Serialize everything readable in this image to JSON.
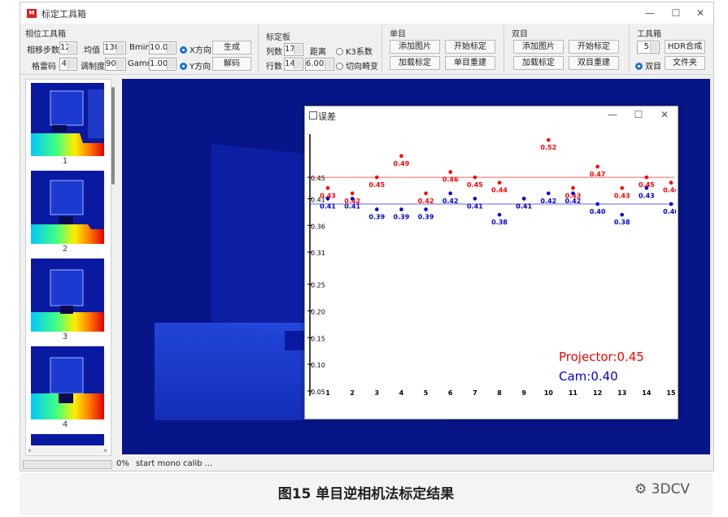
{
  "window": {
    "title": "标定工具箱",
    "controls": [
      "—",
      "☐",
      "✕"
    ]
  },
  "phase_group": {
    "title": "相位工具箱",
    "step_label": "相移步数",
    "step_value": "12",
    "mean_label": "均值",
    "mean_value": "130",
    "bmin_label": "Bmin",
    "bmin_value": "10.00",
    "gray_label": "格雷码",
    "gray_value": "4",
    "mod_label": "调制度",
    "mod_value": "90",
    "gamma_label": "Gamma",
    "gamma_value": "1.00",
    "radio_x": "X方向",
    "radio_y": "Y方向",
    "btn_generate": "生成",
    "btn_decode": "解码"
  },
  "board_group": {
    "title": "标定板",
    "cols_label": "列数",
    "cols_value": "17",
    "rows_label": "行数",
    "rows_value": "14",
    "dist_label": "距离",
    "dist_value": "6.00",
    "radio_k3": "K3系数",
    "radio_tan": "切向畸变"
  },
  "mono_group": {
    "title": "单目",
    "btn_add": "添加图片",
    "btn_start": "开始标定",
    "btn_load": "加载标定",
    "btn_rebuild": "单目重建"
  },
  "stereo_group": {
    "title": "双目",
    "btn_add": "添加图片",
    "btn_start": "开始标定",
    "btn_load": "加载标定",
    "btn_rebuild": "双目重建"
  },
  "tools_group": {
    "title": "工具箱",
    "count_value": "5",
    "btn_hdr": "HDR合成",
    "radio_stereo": "双目",
    "btn_folder": "文件夹"
  },
  "thumbnails": [
    {
      "label": "1"
    },
    {
      "label": "2"
    },
    {
      "label": "3"
    },
    {
      "label": "4"
    }
  ],
  "status": {
    "progress": "0%",
    "message": "start mono calib ..."
  },
  "error_window": {
    "title": "误差",
    "controls": [
      "—",
      "☐",
      "✕"
    ]
  },
  "caption": "图15 单目逆相机法标定结果",
  "watermark": "3DCV",
  "colors": {
    "projector": "#ff0000",
    "camera": "#0000e0",
    "viewport": "#081589"
  },
  "chart_data": {
    "type": "scatter",
    "x": [
      1,
      2,
      3,
      4,
      5,
      6,
      7,
      8,
      9,
      10,
      11,
      12,
      13,
      14,
      15
    ],
    "y_ticks": [
      "0.45",
      "0.41",
      "0.36",
      "0.31",
      "0.25",
      "0.20",
      "0.15",
      "0.10",
      "0.05"
    ],
    "ylim": [
      0.05,
      0.47
    ],
    "series": [
      {
        "name": "Projector",
        "color": "#ff0000",
        "values": [
          0.43,
          0.42,
          0.45,
          0.49,
          0.42,
          0.46,
          0.45,
          0.44,
          0.41,
          0.52,
          0.43,
          0.47,
          0.43,
          0.45,
          0.44
        ],
        "mean": 0.45
      },
      {
        "name": "Cam",
        "color": "#0000e0",
        "values": [
          0.41,
          0.41,
          0.39,
          0.39,
          0.39,
          0.42,
          0.41,
          0.38,
          0.41,
          0.42,
          0.42,
          0.4,
          0.38,
          0.43,
          0.4
        ],
        "mean": 0.4
      }
    ],
    "legend": [
      "Projector:0.45",
      "Cam:0.40"
    ],
    "title": "",
    "xlabel": "",
    "ylabel": ""
  }
}
